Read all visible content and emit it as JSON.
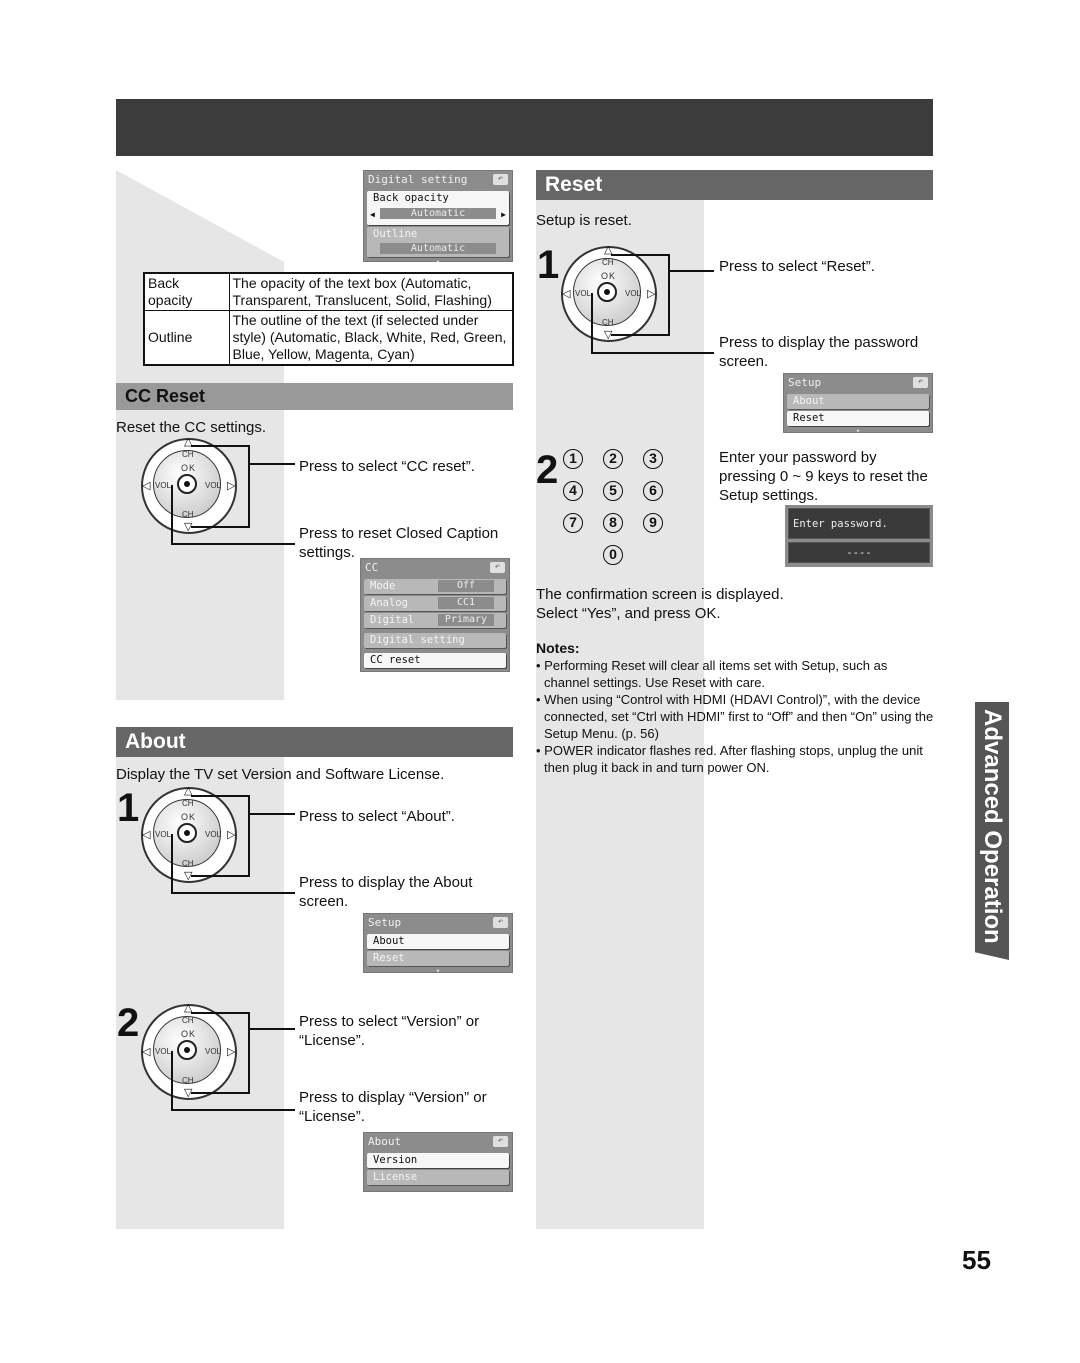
{
  "page_number": "55",
  "side_tab": "Advanced Operation",
  "digital_setting_menu": {
    "title": "Digital setting",
    "items": [
      {
        "label": "Back opacity",
        "value": "Automatic",
        "selected": true
      },
      {
        "label": "Outline",
        "value": "Automatic",
        "selected": false
      }
    ]
  },
  "settings_table": {
    "rows": [
      {
        "name": "Back opacity",
        "description": "The opacity of the text box (Automatic, Transparent, Translucent, Solid, Flashing)"
      },
      {
        "name": "Outline",
        "description": "The outline of the text (if selected under style) (Automatic, Black, White, Red, Green, Blue, Yellow, Magenta, Cyan)"
      }
    ]
  },
  "cc_reset": {
    "title": "CC Reset",
    "intro": "Reset the CC settings.",
    "step_select": "Press to select “CC reset”.",
    "step_ok": "Press to reset Closed Caption settings.",
    "menu": {
      "title": "CC",
      "items": [
        {
          "label": "Mode",
          "value": "Off"
        },
        {
          "label": "Analog",
          "value": "CC1"
        },
        {
          "label": "Digital",
          "value": "Primary"
        },
        {
          "label": "Digital setting",
          "value": ""
        },
        {
          "label": "CC reset",
          "value": "",
          "selected": true
        }
      ]
    }
  },
  "about": {
    "title": "About",
    "intro": "Display the TV set Version and Software License.",
    "step1_num": "1",
    "step1_select": "Press to select “About”.",
    "step1_ok": "Press to display the About screen.",
    "setup_menu": {
      "title": "Setup",
      "items": [
        {
          "label": "About",
          "selected": true
        },
        {
          "label": "Reset",
          "selected": false
        }
      ]
    },
    "step2_num": "2",
    "step2_select": "Press to select “Version” or “License”.",
    "step2_ok": "Press to display “Version” or “License”.",
    "about_menu": {
      "title": "About",
      "items": [
        {
          "label": "Version",
          "selected": true
        },
        {
          "label": "License",
          "selected": false
        }
      ]
    }
  },
  "reset": {
    "title": "Reset",
    "intro": "Setup is reset.",
    "step1_num": "1",
    "step1_select": "Press to select “Reset”.",
    "step1_ok": "Press to display the password screen.",
    "setup_menu": {
      "title": "Setup",
      "items": [
        {
          "label": "About",
          "selected": false
        },
        {
          "label": "Reset",
          "selected": true
        }
      ]
    },
    "step2_num": "2",
    "keys": [
      "1",
      "2",
      "3",
      "4",
      "5",
      "6",
      "7",
      "8",
      "9",
      "0"
    ],
    "step2_text": "Enter your password by pressing 0 ~ 9 keys to reset the Setup settings.",
    "password_prompt": "Enter password.",
    "password_value": "----",
    "confirm_text_1": "The confirmation screen is displayed.",
    "confirm_text_2": "Select “Yes”, and press OK.",
    "notes_title": "Notes:",
    "notes": [
      "Performing Reset will clear all items set with Setup, such as channel settings. Use Reset with care.",
      "When using “Control with HDMI (HDAVI Control)”, with the device connected, set “Ctrl with HDMI” first to “Off” and then “On” using the Setup Menu. (p. 56)",
      "POWER indicator flashes red. After flashing stops, unplug the unit then plug it back in and turn power ON."
    ]
  },
  "remote": {
    "ch": "CH",
    "vol": "VOL",
    "ok": "OK"
  },
  "icons": {
    "back": "↶",
    "left": "◀",
    "right": "▶",
    "down": "▾"
  }
}
